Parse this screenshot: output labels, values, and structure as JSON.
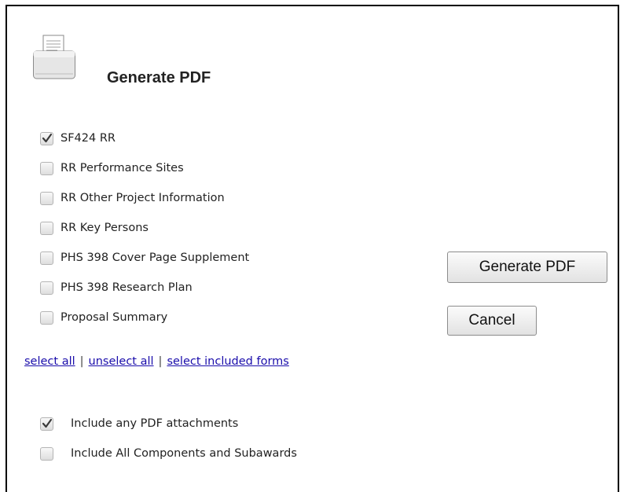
{
  "dialog": {
    "title": "Generate PDF",
    "forms": [
      {
        "label": "SF424 RR",
        "checked": true
      },
      {
        "label": "RR Performance Sites",
        "checked": false
      },
      {
        "label": "RR Other Project Information",
        "checked": false
      },
      {
        "label": "RR Key Persons",
        "checked": false
      },
      {
        "label": "PHS 398 Cover Page Supplement",
        "checked": false
      },
      {
        "label": "PHS 398 Research Plan",
        "checked": false
      },
      {
        "label": "Proposal Summary",
        "checked": false
      }
    ],
    "buttons": {
      "generate": "Generate PDF",
      "cancel": "Cancel"
    },
    "links": {
      "select_all": "select all",
      "unselect_all": "unselect all",
      "select_included": "select included forms",
      "separator": "|"
    },
    "options": [
      {
        "label": "Include any PDF attachments",
        "checked": true
      },
      {
        "label": "Include All Components and Subawards",
        "checked": false
      }
    ]
  }
}
